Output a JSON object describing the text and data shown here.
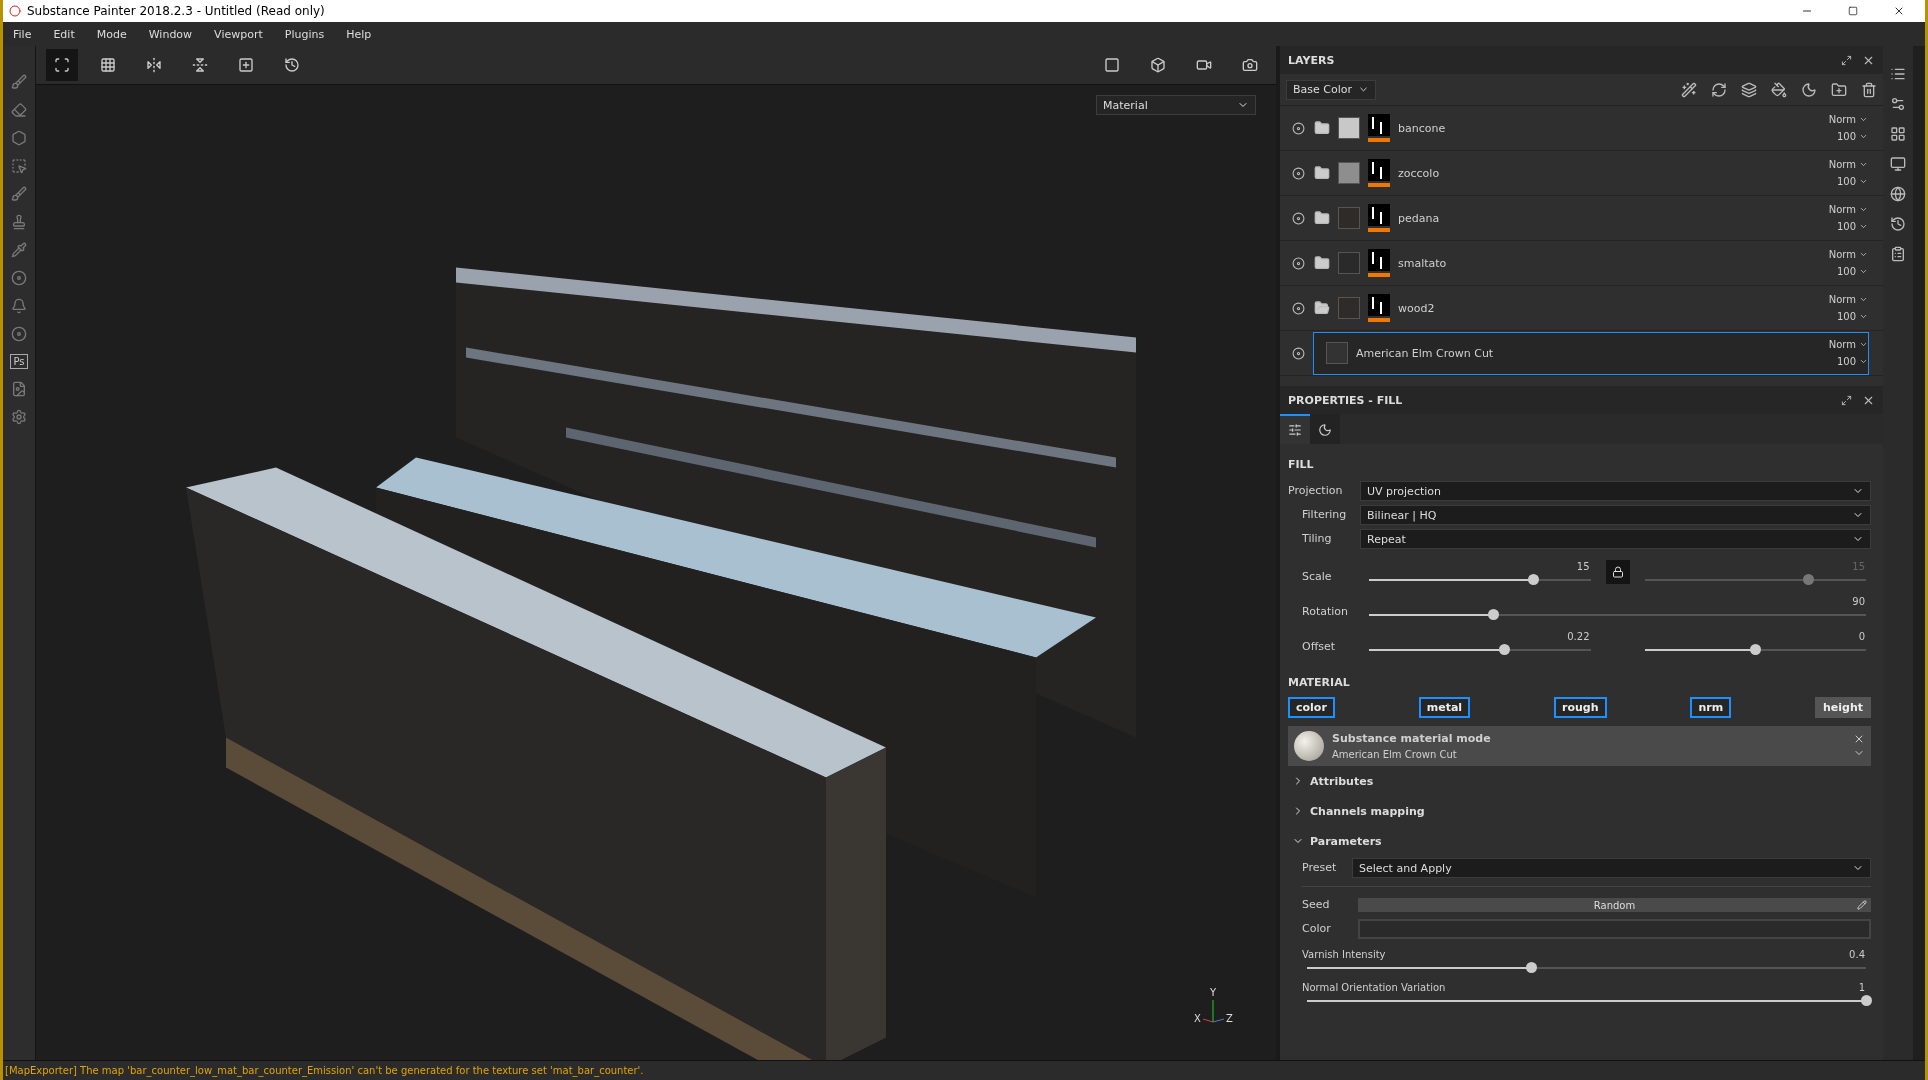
{
  "window": {
    "title": "Substance Painter 2018.2.3 - Untitled (Read only)"
  },
  "menu": [
    "File",
    "Edit",
    "Mode",
    "Window",
    "Viewport",
    "Plugins",
    "Help"
  ],
  "ps_tool": "Ps",
  "viewport": {
    "mode": "Material",
    "axes": [
      "X",
      "Y",
      "Z"
    ]
  },
  "layers": {
    "title": "LAYERS",
    "channel": "Base Color",
    "items": [
      {
        "name": "bancone",
        "kind": "folder",
        "expanded": false,
        "color": "#c8c8c8",
        "blend": "Norm",
        "opacity": "100",
        "selected": false
      },
      {
        "name": "zoccolo",
        "kind": "folder",
        "expanded": false,
        "color": "#8e8e8e",
        "blend": "Norm",
        "opacity": "100",
        "selected": false
      },
      {
        "name": "pedana",
        "kind": "folder",
        "expanded": false,
        "color": "#2e2b28",
        "blend": "Norm",
        "opacity": "100",
        "selected": false
      },
      {
        "name": "smaltato",
        "kind": "folder",
        "expanded": false,
        "color": "#2a2a2a",
        "blend": "Norm",
        "opacity": "100",
        "selected": false
      },
      {
        "name": "wood2",
        "kind": "folder",
        "expanded": true,
        "color": "#2e2b28",
        "blend": "Norm",
        "opacity": "100",
        "selected": false
      },
      {
        "name": "American Elm Crown Cut",
        "kind": "fill",
        "color": "#333333",
        "blend": "Norm",
        "opacity": "100",
        "selected": true
      }
    ]
  },
  "properties": {
    "title": "PROPERTIES - FILL",
    "tabs": [
      {
        "selected": true
      },
      {
        "selected": false
      }
    ],
    "fill": {
      "title": "FILL",
      "dropdowns": [
        {
          "label": "Projection",
          "value": "UV projection"
        },
        {
          "label": "Filtering",
          "value": "Bilinear | HQ"
        },
        {
          "label": "Tiling",
          "value": "Repeat"
        }
      ],
      "sliders": [
        {
          "label": "Scale",
          "values": [
            {
              "reading": "15",
              "level": 0.74,
              "disabled": false
            },
            {
              "reading": "15",
              "level": 0.74,
              "disabled": true
            }
          ],
          "locked": true
        },
        {
          "label": "Rotation",
          "values": [
            {
              "reading": "90",
              "level": 0.25,
              "disabled": false
            }
          ]
        },
        {
          "label": "Offset",
          "values": [
            {
              "reading": "0.22",
              "level": 0.61,
              "disabled": false
            },
            {
              "reading": "0",
              "level": 0.5,
              "disabled": false
            }
          ]
        }
      ]
    },
    "material": {
      "title": "MATERIAL",
      "channels": [
        {
          "label": "color",
          "selected": true
        },
        {
          "label": "metal",
          "selected": true
        },
        {
          "label": "rough",
          "selected": true
        },
        {
          "label": "nrm",
          "selected": true
        },
        {
          "label": "height",
          "selected": false
        }
      ],
      "mode": "Substance material mode",
      "name": "American Elm Crown Cut",
      "sections": [
        {
          "label": "Attributes",
          "expanded": false
        },
        {
          "label": "Channels mapping",
          "expanded": false
        },
        {
          "label": "Parameters",
          "expanded": true
        }
      ],
      "preset": {
        "label": "Preset",
        "value": "Select and Apply"
      },
      "seed": {
        "label": "Seed",
        "value": "Random"
      },
      "color": {
        "label": "Color"
      },
      "params": [
        {
          "label": "Varnish Intensity",
          "reading": "0.4",
          "level": 0.4
        },
        {
          "label": "Normal Orientation Variation",
          "reading": "1",
          "level": 1
        }
      ]
    }
  },
  "status": "[MapExporter] The map 'bar_counter_low_mat_bar_counter_Emission' can't be generated for the texture set 'mat_bar_counter'."
}
